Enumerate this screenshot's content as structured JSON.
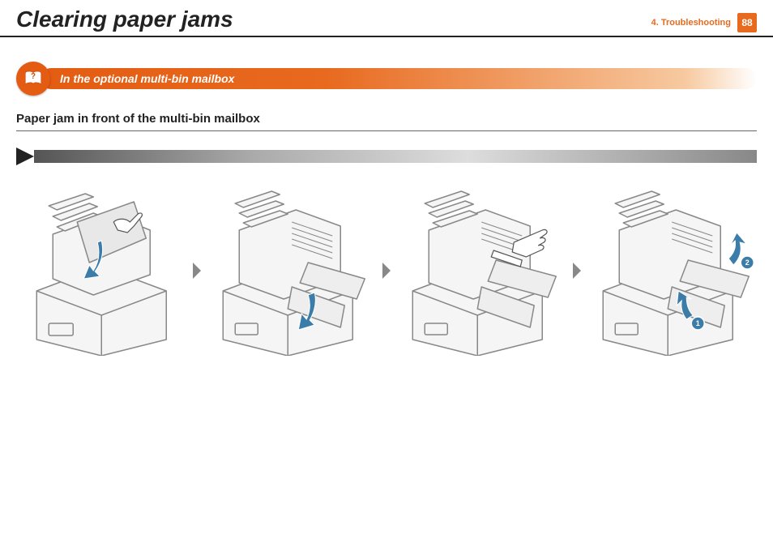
{
  "header": {
    "title": "Clearing paper jams",
    "chapter": "4.  Troubleshooting",
    "page": "88"
  },
  "section": {
    "title": "In the optional multi-bin mailbox"
  },
  "subheading": "Paper jam in front of the multi-bin mailbox",
  "callouts": {
    "one": "1",
    "two": "2"
  }
}
